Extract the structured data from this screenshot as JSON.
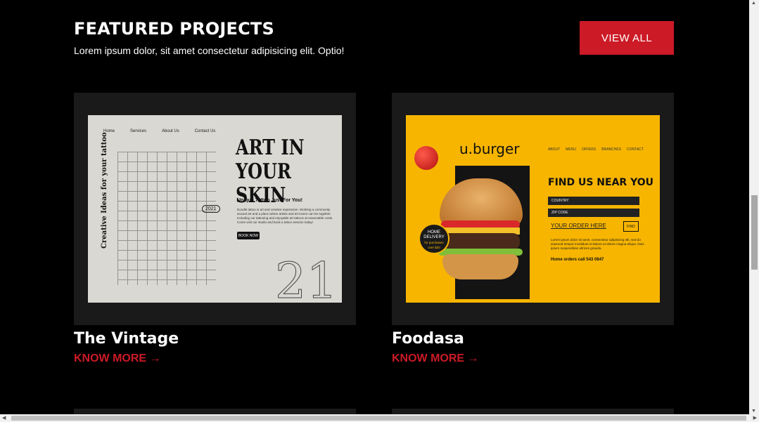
{
  "header": {
    "title": "FEATURED PROJECTS",
    "subtitle": "Lorem ipsum dolor, sit amet consectetur adipisicing elit. Optio!",
    "view_all": "VIEW ALL"
  },
  "colors": {
    "accent": "#cc1a26",
    "background": "#000000",
    "card_bg": "#1a1a1a"
  },
  "projects": [
    {
      "title": "The Vintage",
      "link": "KNOW MORE →",
      "mockup": {
        "nav": [
          "Home",
          "Services",
          "About Us",
          "Contact Us"
        ],
        "vertical": "Creative Ideas for your tattoo",
        "headline_1": "ART IN",
        "headline_2": "YOUR SKIN",
        "tagline": "Unique Tattoo Just For You!",
        "body": "Doodle tattoo is art and creative expression. Working a community around art and a place where artists and art lovers can be together. Including our tattooing and enjoyable art tattoos at reasonable costs. Come visit our studio and book a tattoo session today!",
        "button": "BOOK NOW",
        "year": "2021",
        "number": "21"
      }
    },
    {
      "title": "Foodasa",
      "link": "KNOW MORE →",
      "mockup": {
        "logo": "u.burger",
        "nav": [
          "ABOUT",
          "MENU",
          "OFFERS",
          "BRANCHES",
          "CONTACT"
        ],
        "headline": "FIND US NEAR YOU",
        "select_1": "COUNTRY",
        "select_2": "ZIP CODE",
        "order_link": "YOUR ORDER HERE",
        "find_button": "FIND",
        "body": "Lorem ipsum dolor sit amet, consectetur adipisicing elit, sed do eiusmod tempor incididunt ut labore et dolore magna aliqua. Duis ipsum suspendisse ultrices gravida.",
        "call": "Home orders call 543 0847",
        "delivery_1": "HOME",
        "delivery_2": "DELIVERY",
        "delivery_3": "for purchases",
        "delivery_4": "over $20"
      }
    }
  ]
}
